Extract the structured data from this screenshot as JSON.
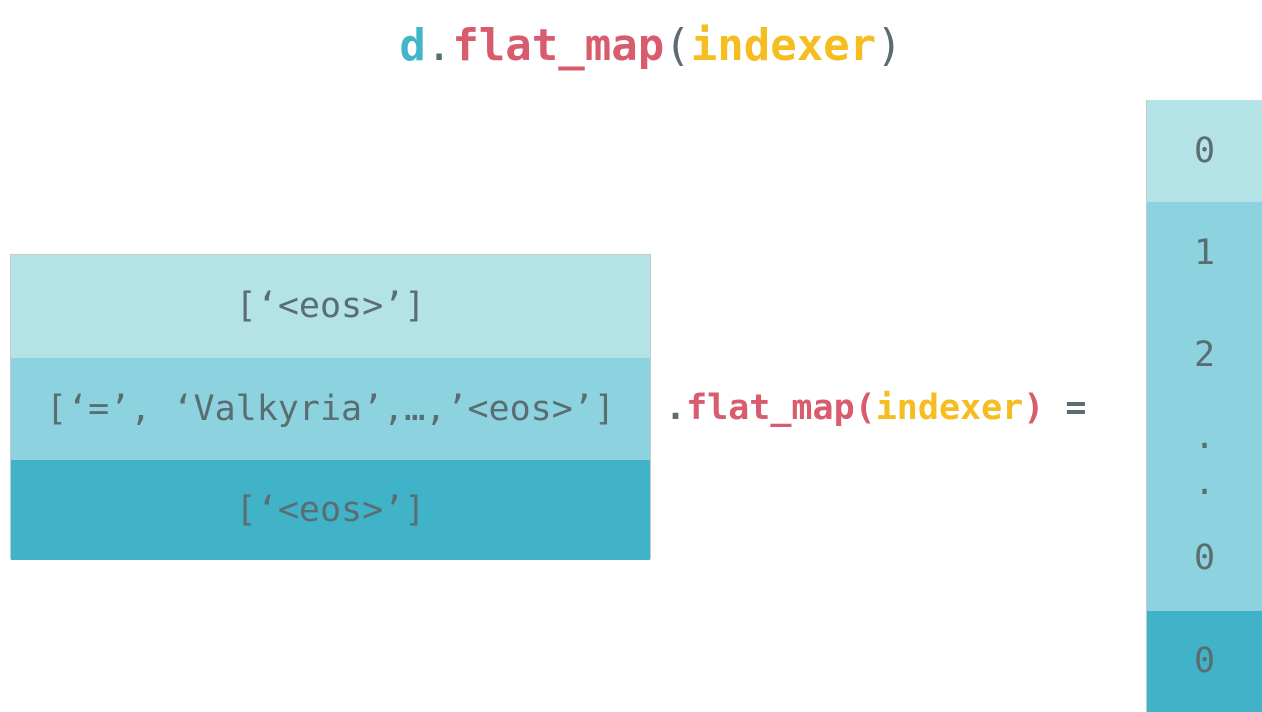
{
  "title": {
    "var": "d",
    "dot": ".",
    "func": "flat_map",
    "open_paren": "(",
    "arg": "indexer",
    "close_paren": ")"
  },
  "input_rows": [
    "[‘<eos>’]",
    "[‘=’, ‘Valkyria’,…,’<eos>’]",
    "[‘<eos>’]"
  ],
  "operation": {
    "dot": ".",
    "func": "flat_map",
    "open_paren": "(",
    "arg": "indexer",
    "close_paren": ")",
    "equals": " ="
  },
  "output_values": [
    "0",
    "1",
    "2",
    ".",
    ".",
    "0",
    "0"
  ],
  "colors": {
    "light_teal": "#b3e2e7",
    "mid_teal": "#8dd3df",
    "dark_teal": "#40b3c8",
    "text_gray": "#5a6e72",
    "pink": "#d85c6e",
    "yellow": "#f5bd1f",
    "title_var_teal": "#42b6c8"
  }
}
